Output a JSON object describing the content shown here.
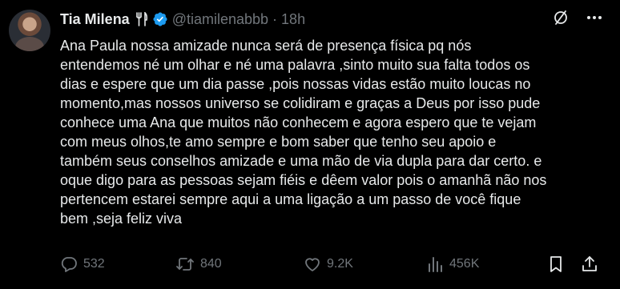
{
  "tweet": {
    "display_name": "Tia Milena",
    "handle": "@tiamilenabbb",
    "separator": "·",
    "time": "18h",
    "text": "Ana Paula nossa amizade nunca será de presença física pq nós\nentendemos né um olhar e né uma palavra ,sinto muito sua falta todos os\ndias e espere que um dia passe ,pois nossas vidas estão muito loucas no\nmomento,mas nossos universo se colidiram e graças a Deus por isso pude\nconhece uma Ana que muitos não conhecem e agora espero que te vejam\ncom meus olhos,te amo sempre e bom saber que tenho seu apoio e\ntambém seus conselhos amizade e uma mão de via dupla para dar certo. e\noque digo para as pessoas sejam fiéis e dêem valor pois o amanhã não nos\npertencem estarei sempre aqui a uma ligação a um passo de você fique\nbem ,seja feliz viva",
    "metrics": {
      "replies": "532",
      "reposts": "840",
      "likes": "9.2K",
      "views": "456K"
    }
  },
  "icons": {
    "name_badge": "fork-knife-icon",
    "verified": "verified-badge-icon",
    "grok": "grok-icon",
    "more": "more-dots-icon",
    "reply": "reply-icon",
    "repost": "repost-icon",
    "like": "heart-icon",
    "views": "views-icon",
    "bookmark": "bookmark-icon",
    "share": "share-icon"
  },
  "colors": {
    "background": "#000000",
    "text": "#e7e9ea",
    "secondary": "#71767b",
    "verified": "#1d9bf0"
  }
}
